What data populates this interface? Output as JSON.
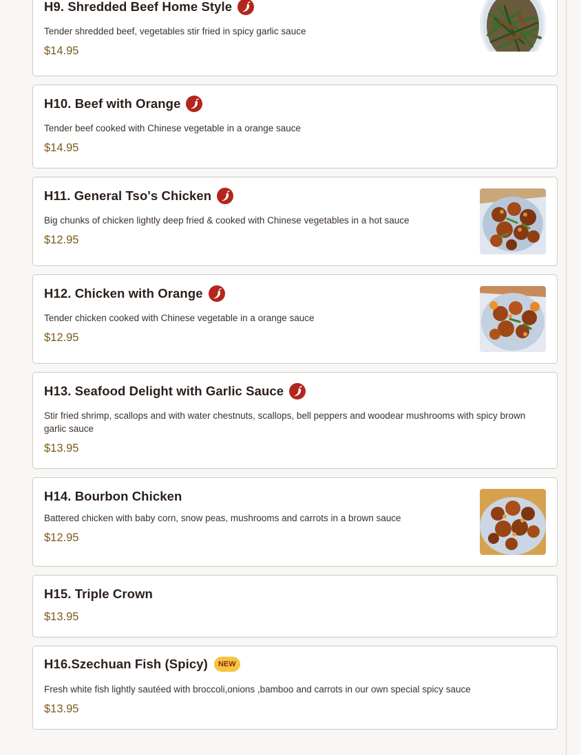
{
  "items": [
    {
      "title": "H9. Shredded Beef Home Style",
      "spicy": true,
      "desc": "Tender shredded beef, vegetables stir fried in spicy garlic sauce",
      "price": "$14.95",
      "photo": "shredded-beef"
    },
    {
      "title": "H10. Beef with Orange",
      "spicy": true,
      "desc": "Tender beef cooked with Chinese vegetable in a orange sauce",
      "price": "$14.95"
    },
    {
      "title": "H11. General Tso's Chicken",
      "spicy": true,
      "desc": "Big chunks of chicken lightly deep fried & cooked with Chinese vegetables in a hot sauce",
      "price": "$12.95",
      "photo": "general-tso"
    },
    {
      "title": "H12. Chicken with Orange",
      "spicy": true,
      "desc": "Tender chicken cooked with Chinese vegetable in a orange sauce",
      "price": "$12.95",
      "photo": "orange-chicken"
    },
    {
      "title": "H13. Seafood Delight with Garlic Sauce",
      "spicy": true,
      "desc": "Stir fried shrimp, scallops and with water chestnuts, scallops, bell peppers and woodear mushrooms with spicy brown garlic sauce",
      "price": "$13.95"
    },
    {
      "title": "H14. Bourbon Chicken",
      "spicy": false,
      "desc": "Battered chicken with baby corn, snow peas, mushrooms and carrots in a brown sauce",
      "price": "$12.95",
      "photo": "bourbon-chicken"
    },
    {
      "title": "H15. Triple Crown",
      "spicy": false,
      "price": "$13.95"
    },
    {
      "title": "H16.Szechuan Fish (Spicy)",
      "spicy": false,
      "badge": "NEW",
      "desc": "Fresh white fish lightly sautéed with broccoli,onions ,bamboo and carrots in our own special spicy sauce",
      "price": "$13.95"
    }
  ],
  "icons": {
    "spicy": "chili-pepper-icon"
  },
  "colors": {
    "spicy_badge": "#b3261e",
    "new_badge": "#f5c542",
    "price": "#7a5a1c"
  }
}
